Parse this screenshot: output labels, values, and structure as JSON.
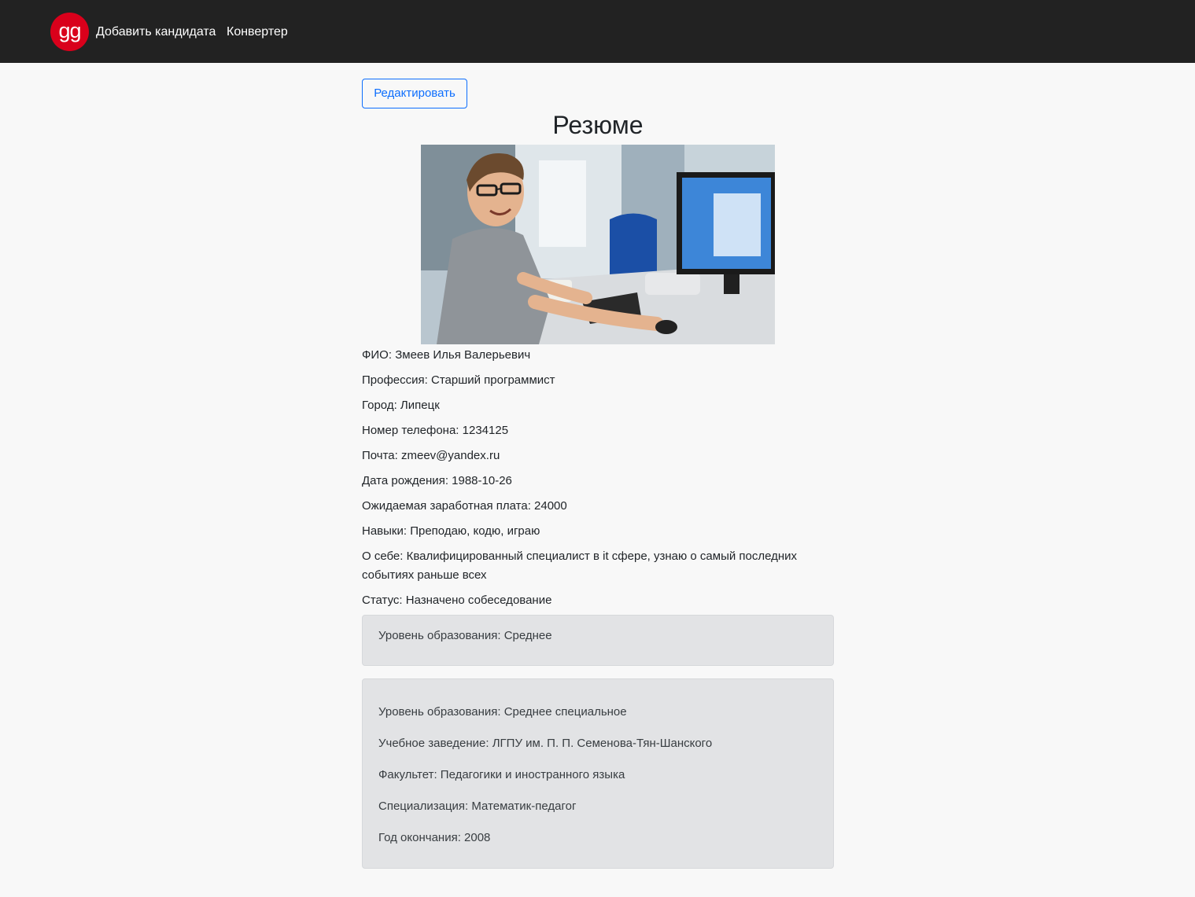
{
  "navbar": {
    "logo_text": "gg",
    "links": [
      "Добавить кандидата",
      "Конвертер"
    ]
  },
  "toolbar": {
    "edit_label": "Редактировать"
  },
  "page": {
    "title": "Резюме"
  },
  "resume": {
    "fio": {
      "label": "ФИО:",
      "value": "Змеев Илья Валерьевич"
    },
    "profession": {
      "label": "Профессия:",
      "value": "Старший программист"
    },
    "city": {
      "label": "Город:",
      "value": "Липецк"
    },
    "phone": {
      "label": "Номер телефона:",
      "value": "1234125"
    },
    "email": {
      "label": "Почта:",
      "value": "zmeev@yandex.ru"
    },
    "birth_date": {
      "label": "Дата рождения:",
      "value": "1988-10-26"
    },
    "salary": {
      "label": "Ожидаемая заработная плата:",
      "value": "24000"
    },
    "skills": {
      "label": "Навыки:",
      "value": "Преподаю, кодю, играю"
    },
    "about": {
      "label": "О себе:",
      "value": "Квалифицированный специалист в it сфере, узнаю о самый последних событиях раньше всех"
    },
    "status": {
      "label": "Статус:",
      "value": "Назначено собеседование"
    }
  },
  "education": [
    {
      "level": "Уровень образования: Среднее"
    },
    {
      "level": "Уровень образования: Среднее специальное",
      "institution": "Учебное заведение: ЛГПУ им. П. П. Семенова-Тян-Шанского",
      "faculty": "Факультет: Педагогики и иностранного языка",
      "specialization": "Специализация: Математик-педагог",
      "graduation_year": "Год окончания: 2008"
    }
  ],
  "colors": {
    "navbar_bg": "#222222",
    "logo_bg": "#d9001b",
    "accent": "#0d6efd",
    "page_bg": "#f8f8f8",
    "card_bg": "#e2e3e5"
  }
}
